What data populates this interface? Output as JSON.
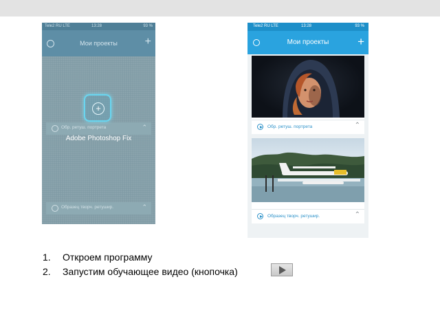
{
  "left_phone": {
    "status": {
      "carrier": "Tele2 RU LTE",
      "time": "13:28",
      "battery": "93 %"
    },
    "nav_title": "Мои проекты",
    "app_name": "Adobe Photoshop Fix",
    "ghost_cards": [
      "Обр. ретуш. портрета",
      "Образец творч. ретушир."
    ]
  },
  "right_phone": {
    "status": {
      "carrier": "Tele2 RU  LTE",
      "time": "13:28",
      "battery": "93 %"
    },
    "nav_title": "Мои проекты",
    "projects": [
      {
        "title": "Обр. ретуш. портрета"
      },
      {
        "title": "Образец творч. ретушир."
      }
    ]
  },
  "steps": [
    {
      "num": "1.",
      "text": "Откроем программу"
    },
    {
      "num": "2.",
      "text": "Запустим обучающее видео (кнопочка)"
    }
  ],
  "colors": {
    "accent": "#2aa3df",
    "link": "#2a90c8"
  }
}
